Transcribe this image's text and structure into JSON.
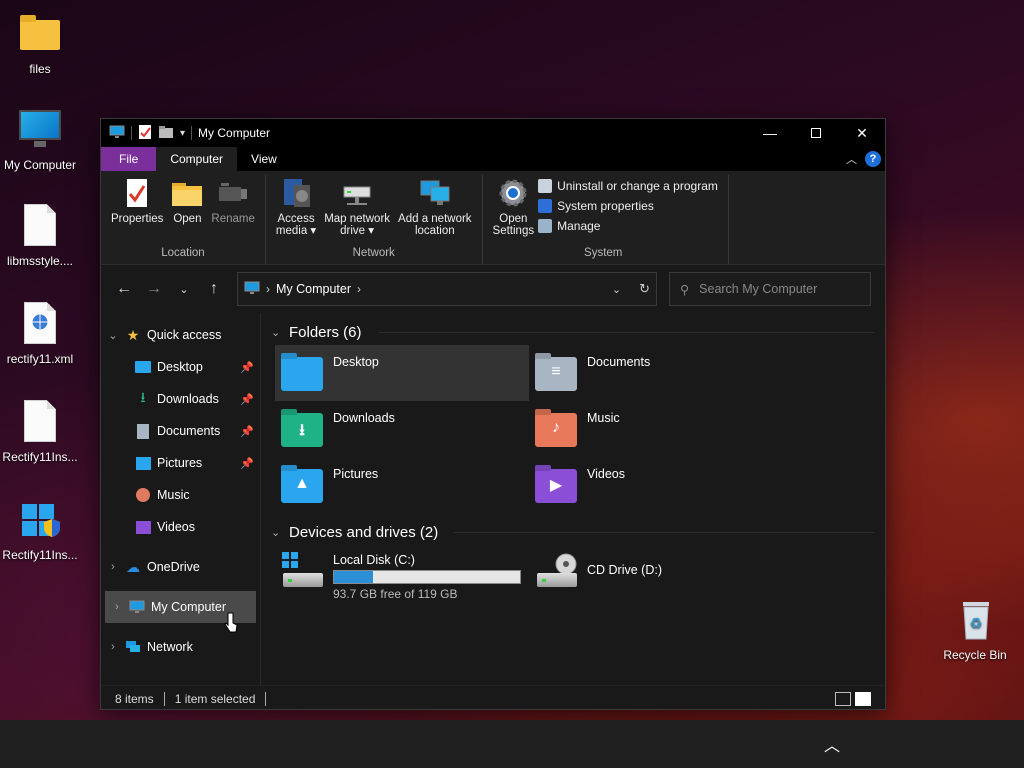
{
  "desktop": {
    "icons": [
      {
        "label": "files",
        "icon": "folder-icon"
      },
      {
        "label": "My Computer",
        "icon": "monitor-icon"
      },
      {
        "label": "libmsstyle....",
        "icon": "blank-file-icon"
      },
      {
        "label": "rectify11.xml",
        "icon": "xml-file-icon"
      },
      {
        "label": "Rectify11Ins...",
        "icon": "blank-file-icon"
      },
      {
        "label": "Rectify11Ins...",
        "icon": "installer-shield-icon"
      },
      {
        "label": "Recycle Bin",
        "icon": "recycle-bin-icon"
      }
    ]
  },
  "window": {
    "title": "My Computer",
    "tabs": [
      "File",
      "Computer",
      "View"
    ],
    "active_tab": "Computer",
    "ribbon": {
      "location": {
        "title": "Location",
        "buttons": [
          "Properties",
          "Open",
          "Rename"
        ]
      },
      "network": {
        "title": "Network",
        "access_media": [
          "Access",
          "media"
        ],
        "map_drive": [
          "Map network",
          "drive"
        ],
        "add_location": [
          "Add a network",
          "location"
        ]
      },
      "system": {
        "title": "System",
        "open_settings": [
          "Open",
          "Settings"
        ],
        "links": [
          "Uninstall or change a program",
          "System properties",
          "Manage"
        ]
      }
    },
    "address": {
      "path": "My Computer"
    },
    "search": {
      "placeholder": "Search My Computer"
    },
    "sidebar": {
      "quick_access": "Quick access",
      "quick_items": [
        {
          "label": "Desktop",
          "pinned": true
        },
        {
          "label": "Downloads",
          "pinned": true
        },
        {
          "label": "Documents",
          "pinned": true
        },
        {
          "label": "Pictures",
          "pinned": true
        },
        {
          "label": "Music",
          "pinned": false
        },
        {
          "label": "Videos",
          "pinned": false
        }
      ],
      "onedrive": "OneDrive",
      "my_computer": "My Computer",
      "network": "Network"
    },
    "content": {
      "folders_header": "Folders (6)",
      "folders": [
        "Desktop",
        "Documents",
        "Downloads",
        "Music",
        "Pictures",
        "Videos"
      ],
      "selected_folder": "Desktop",
      "drives_header": "Devices and drives (2)",
      "drives": [
        {
          "name": "Local Disk (C:)",
          "free_text": "93.7 GB free of 119 GB",
          "used_fraction": 0.21
        },
        {
          "name": "CD Drive (D:)"
        }
      ]
    },
    "status": {
      "items": "8 items",
      "selected": "1 item selected"
    }
  },
  "colors": {
    "file_tab": "#7a2f9a",
    "accent": "#2b8fd6",
    "window_bg": "#191919"
  }
}
